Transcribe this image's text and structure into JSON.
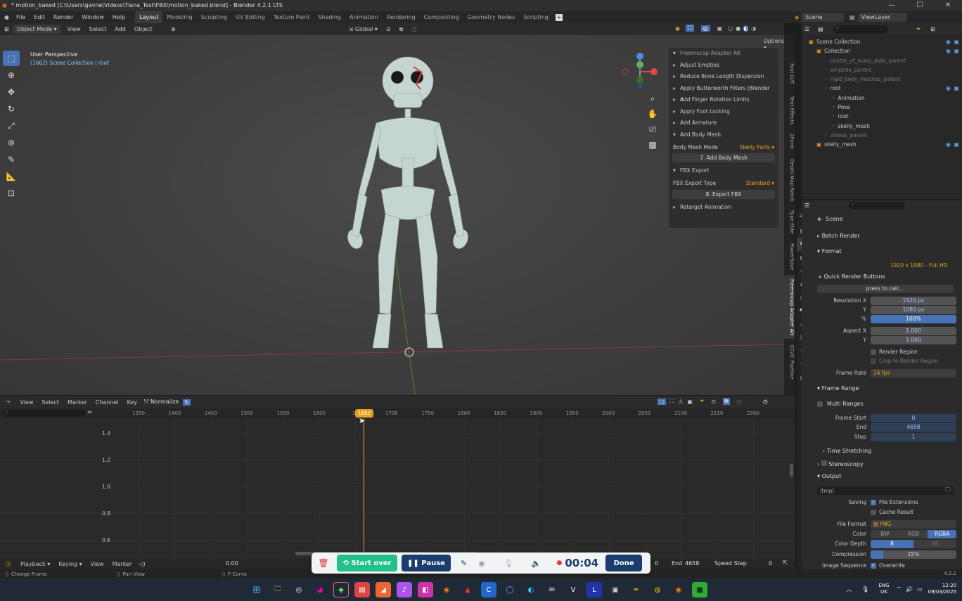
{
  "titlebar": {
    "title": "* motion_baked [C:\\Users\\gavne\\Videos\\Tiana_Test\\FBX\\motion_baked.blend] - Blender 4.2.1 LTS"
  },
  "menu": [
    "File",
    "Edit",
    "Render",
    "Window",
    "Help"
  ],
  "workspaces": [
    "Layout",
    "Modeling",
    "Sculpting",
    "UV Editing",
    "Texture Paint",
    "Shading",
    "Animation",
    "Rendering",
    "Compositing",
    "Geometry Nodes",
    "Scripting"
  ],
  "top_right": {
    "scene": "Scene",
    "view_layer": "ViewLayer"
  },
  "viewport_header": {
    "mode": "Object Mode",
    "items": [
      "View",
      "Select",
      "Add",
      "Object"
    ],
    "orientation": "Global",
    "options": "Options"
  },
  "viewport": {
    "perspective": "User Perspective",
    "collection": "(1662) Scene Collection | root"
  },
  "npanel": {
    "title": "Freemocap Adapter Alt",
    "rows": [
      "Adjust Empties",
      "Reduce Bone Length Dispersion",
      "Apply Butterworth Filters (Blender 4....",
      "Add Finger Rotation Limits",
      "Apply Foot Locking",
      "Add Armature"
    ],
    "body_mesh": {
      "header": "Add Body Mesh",
      "mode_label": "Body Mesh Mode",
      "mode_value": "Skelly Parts",
      "button": "7. Add Body Mesh"
    },
    "fbx": {
      "header": "FBX Export",
      "type_label": "FBX Export Type",
      "type_value": "Standard",
      "button": "8. Export FBX"
    },
    "retarget": "Retarget Animation"
  },
  "vtabs": [
    "Fast LUT",
    "Text Effects",
    "2Form",
    "Depth Map Batch",
    "Type Elite",
    "PowerSave",
    "Freemocap Adapter Alt",
    "CC/iC Pipeline"
  ],
  "outliner": {
    "rows": [
      {
        "label": "Scene Collection",
        "indent": 0,
        "dim": false
      },
      {
        "label": "Collection",
        "indent": 1,
        "dim": false
      },
      {
        "label": "center_of_mass_data_parent",
        "indent": 2,
        "dim": true
      },
      {
        "label": "empties_parent",
        "indent": 2,
        "dim": true
      },
      {
        "label": "rigid_body_meshes_parent",
        "indent": 2,
        "dim": true
      },
      {
        "label": "root",
        "indent": 2,
        "dim": false
      },
      {
        "label": "Animation",
        "indent": 3,
        "dim": false
      },
      {
        "label": "Pose",
        "indent": 3,
        "dim": false
      },
      {
        "label": "root",
        "indent": 3,
        "dim": false
      },
      {
        "label": "skelly_mesh",
        "indent": 3,
        "dim": false
      },
      {
        "label": "videos_parent",
        "indent": 2,
        "dim": true
      },
      {
        "label": "skelly_mesh",
        "indent": 1,
        "dim": false
      }
    ]
  },
  "props": {
    "scene": "Scene",
    "batch_render": "Batch Render",
    "format": "Format",
    "preset": "1920 x 1080 - Full HD",
    "quick": "Quick Render Buttons",
    "press": "press to calc...",
    "res_x_label": "Resolution X",
    "res_x": "1920 px",
    "res_y_label": "Y",
    "res_y": "1080 px",
    "pct_label": "%",
    "pct": "100%",
    "aspect_x_label": "Aspect X",
    "aspect_x": "1.000",
    "aspect_y_label": "Y",
    "aspect_y": "1.000",
    "render_region": "Render Region",
    "crop": "Crop to Render Region",
    "fps_label": "Frame Rate",
    "fps": "24 fps",
    "frame_range": "Frame Range",
    "multi": "Multi Ranges",
    "start_label": "Frame Start",
    "start": "0",
    "end_label": "End",
    "end": "4658",
    "step_label": "Step",
    "step": "1",
    "time_stretch": "Time Stretching",
    "stereo": "Stereoscopy",
    "output": "Output",
    "path": "/tmp\\",
    "saving": "Saving",
    "file_ext": "File Extensions",
    "cache": "Cache Result",
    "file_format_label": "File Format",
    "file_format": "PNG",
    "color_label": "Color",
    "color_opts": [
      "BW",
      "RGB",
      "RGBA"
    ],
    "depth_label": "Color Depth",
    "depth_opts": [
      "8",
      "16"
    ],
    "compression_label": "Compression",
    "compression": "15%",
    "compression_level": 0.15,
    "image_seq": "Image Sequence",
    "overwrite": "Overwrite"
  },
  "graph_editor": {
    "header": [
      "View",
      "Select",
      "Marker",
      "Channel",
      "Key"
    ],
    "normalize": "Normalize",
    "ticks": [
      "1350",
      "1400",
      "1450",
      "1500",
      "1550",
      "1600",
      "16",
      "1700",
      "1750",
      "1800",
      "1850",
      "1900",
      "1950",
      "2000",
      "2050",
      "2100",
      "2150",
      "2200"
    ],
    "current_frame": "1662",
    "y_labels": [
      "1.4",
      "1.2",
      "1.0",
      "0.8",
      "0.6"
    ]
  },
  "timeline": {
    "playback": "Playback",
    "keying": "Keying",
    "view": "View",
    "marker": "Marker",
    "time": "0.00",
    "start": "0",
    "end_label": "End",
    "end": "4658",
    "speed": "Speed Step",
    "speed_val": "0"
  },
  "status": {
    "left": "Change Frame",
    "pan": "Pan View",
    "fcurve": "F-Curve",
    "version": "4.2.1"
  },
  "recorder": {
    "start_over": "Start over",
    "pause": "Pause",
    "time": "00:04",
    "done": "Done"
  },
  "taskbar": {
    "lang": "ENG",
    "region": "UK",
    "time": "12:20",
    "date": "09/03/2025"
  }
}
